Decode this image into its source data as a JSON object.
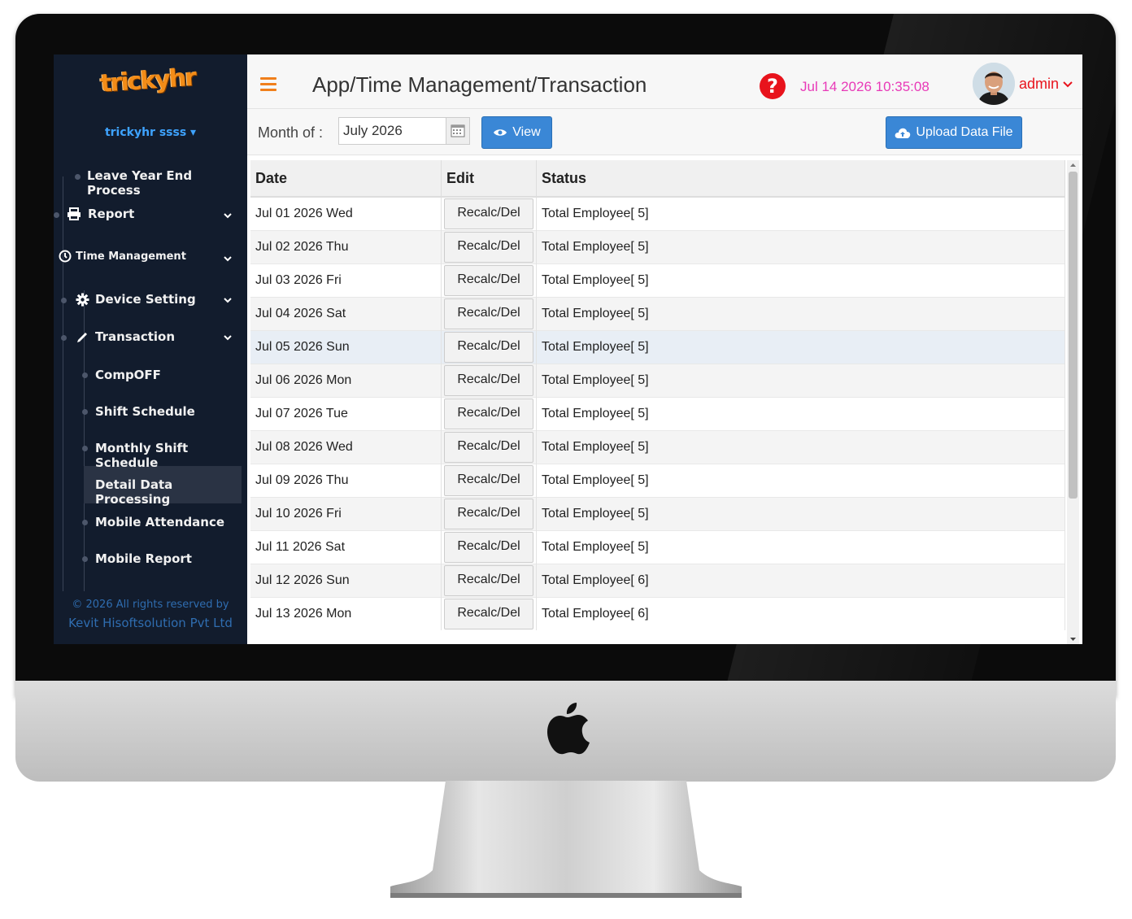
{
  "sidebar": {
    "brand": "trickyhr",
    "user_label": "trickyhr ssss ▾",
    "items": {
      "leave_year_end": "Leave Year End Process",
      "report": "Report",
      "time_management": "Time Management",
      "device_setting": "Device Setting",
      "transaction": "Transaction",
      "compoff": "CompOFF",
      "shift_schedule": "Shift Schedule",
      "monthly_shift_schedule": "Monthly Shift Schedule",
      "detail_data_processing": "Detail Data Processing",
      "mobile_attendance": "Mobile Attendance",
      "mobile_report": "Mobile Report"
    },
    "footer_line1": "© 2026 All rights reserved by",
    "footer_line2": "Kevit Hisoftsolution Pvt Ltd"
  },
  "header": {
    "title": "App/Time Management/Transaction",
    "help_icon": "?",
    "datetime": "Jul 14 2026 10:35:08",
    "user": "admin"
  },
  "toolbar": {
    "month_label": "Month of :",
    "month_value": "July 2026",
    "view_label": "View",
    "upload_label": "Upload Data File"
  },
  "table": {
    "columns": [
      "Date",
      "Edit",
      "Status"
    ],
    "rows": [
      {
        "date": "Jul 01 2026 Wed",
        "edit": "Recalc/Del",
        "status": "Total Employee[ 5]"
      },
      {
        "date": "Jul 02 2026 Thu",
        "edit": "Recalc/Del",
        "status": "Total Employee[ 5]"
      },
      {
        "date": "Jul 03 2026 Fri",
        "edit": "Recalc/Del",
        "status": "Total Employee[ 5]"
      },
      {
        "date": "Jul 04 2026 Sat",
        "edit": "Recalc/Del",
        "status": "Total Employee[ 5]"
      },
      {
        "date": "Jul 05 2026 Sun",
        "edit": "Recalc/Del",
        "status": "Total Employee[ 5]"
      },
      {
        "date": "Jul 06 2026 Mon",
        "edit": "Recalc/Del",
        "status": "Total Employee[ 5]"
      },
      {
        "date": "Jul 07 2026 Tue",
        "edit": "Recalc/Del",
        "status": "Total Employee[ 5]"
      },
      {
        "date": "Jul 08 2026 Wed",
        "edit": "Recalc/Del",
        "status": "Total Employee[ 5]"
      },
      {
        "date": "Jul 09 2026 Thu",
        "edit": "Recalc/Del",
        "status": "Total Employee[ 5]"
      },
      {
        "date": "Jul 10 2026 Fri",
        "edit": "Recalc/Del",
        "status": "Total Employee[ 5]"
      },
      {
        "date": "Jul 11 2026 Sat",
        "edit": "Recalc/Del",
        "status": "Total Employee[ 5]"
      },
      {
        "date": "Jul 12 2026 Sun",
        "edit": "Recalc/Del",
        "status": "Total Employee[ 6]"
      },
      {
        "date": "Jul 13 2026 Mon",
        "edit": "Recalc/Del",
        "status": "Total Employee[ 6]"
      }
    ]
  },
  "icons": {
    "menu": "hamburger-icon",
    "help": "question-icon",
    "calendar": "calendar-icon",
    "view": "eye-icon",
    "upload": "cloud-upload-icon",
    "report": "printer-icon",
    "time": "clock-icon",
    "device": "gear-icon",
    "transaction": "pencil-icon"
  },
  "colors": {
    "accent_orange": "#f07f1b",
    "primary_blue": "#3a87d6",
    "sidebar_bg": "#121c2d",
    "clock_pink": "#e83ab8",
    "admin_red": "#e8131c"
  }
}
